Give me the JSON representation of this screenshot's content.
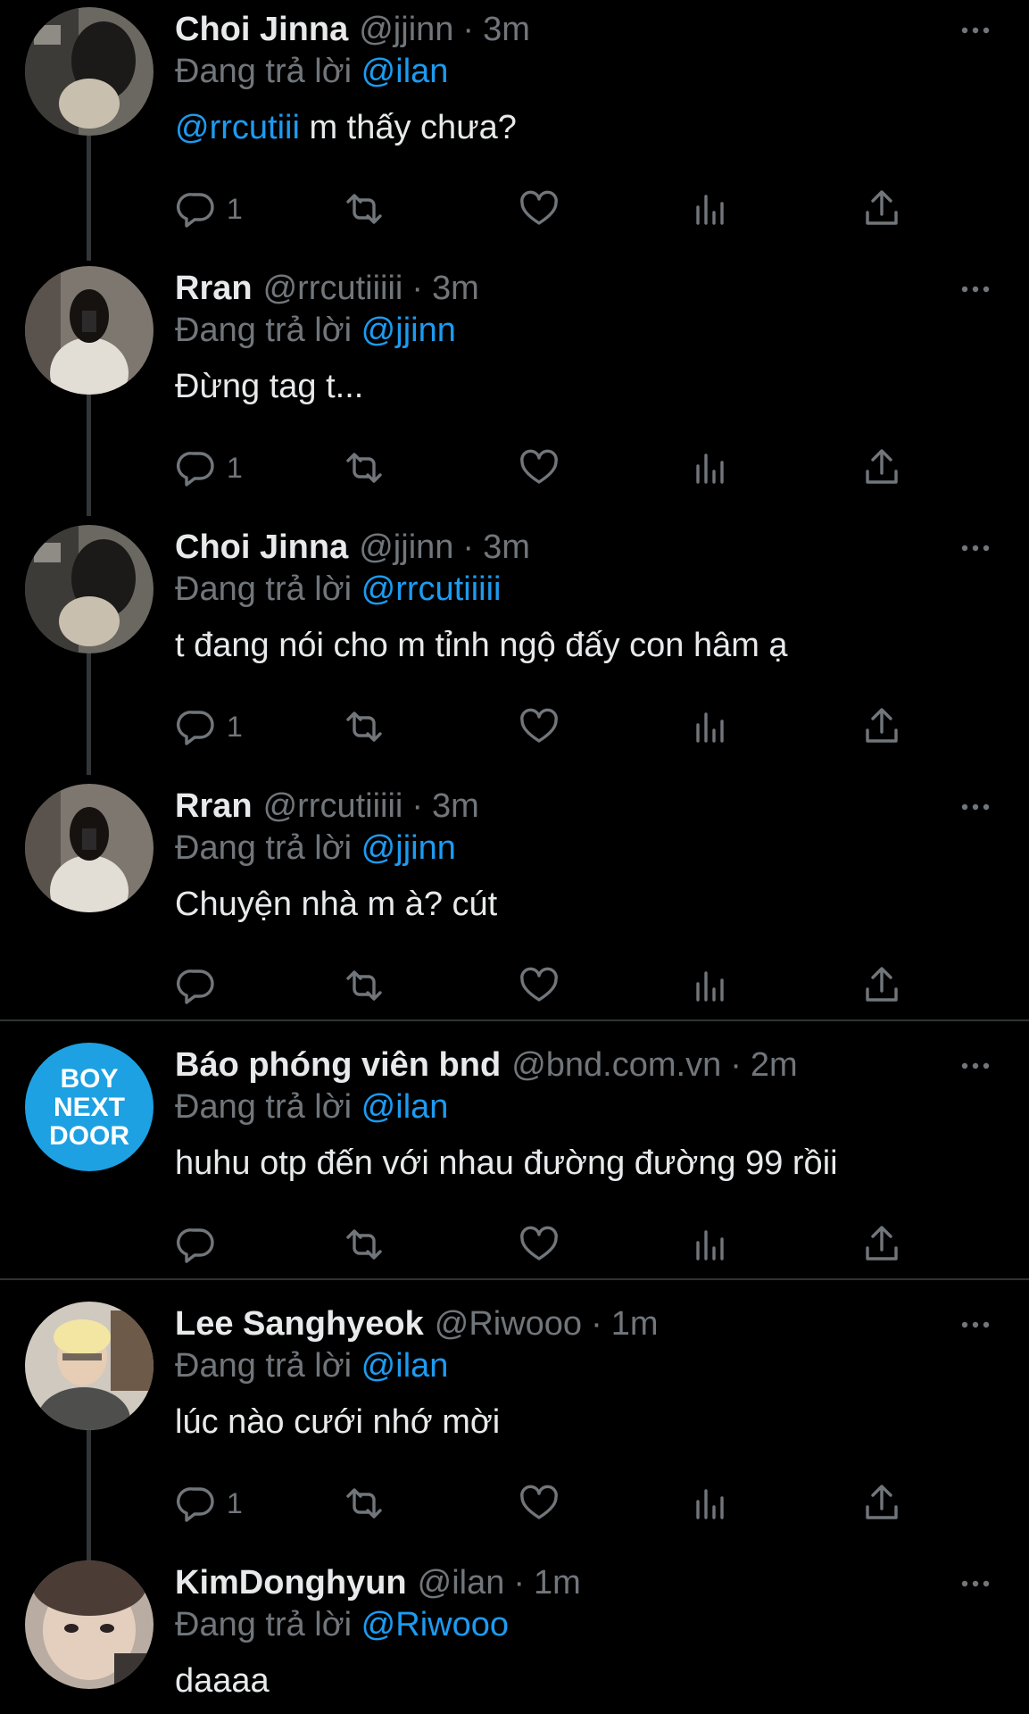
{
  "replying_prefix": "Đang trả lời",
  "tweets": [
    {
      "name": "Choi Jinna",
      "handle": "@jjinn",
      "time": "3m",
      "replying_to": "@ilan",
      "mention": "@rrcutiii",
      "text": " m thấy chưa?",
      "reply_count": "1"
    },
    {
      "name": "Rran",
      "handle": "@rrcutiiiii",
      "time": "3m",
      "replying_to": "@jjinn",
      "mention": "",
      "text": "Đừng tag t...",
      "reply_count": "1"
    },
    {
      "name": "Choi Jinna",
      "handle": "@jjinn",
      "time": "3m",
      "replying_to": "@rrcutiiiii",
      "mention": "",
      "text": "t đang nói cho m tỉnh ngộ đấy con hâm ạ",
      "reply_count": "1"
    },
    {
      "name": "Rran",
      "handle": "@rrcutiiiii",
      "time": "3m",
      "replying_to": "@jjinn",
      "mention": "",
      "text": "Chuyện nhà m à? cút",
      "reply_count": ""
    },
    {
      "name": "Báo phóng viên bnd",
      "handle": "@bnd.com.vn",
      "time": "2m",
      "replying_to": "@ilan",
      "mention": "",
      "text": "huhu otp đến với nhau đường đường 99 rồii",
      "reply_count": "",
      "avatar_text": [
        "BOY",
        "NEXT",
        "DOOR"
      ]
    },
    {
      "name": "Lee Sanghyeok",
      "handle": "@Riwooo",
      "time": "1m",
      "replying_to": "@ilan",
      "mention": "",
      "text": "lúc nào cưới nhớ mời",
      "reply_count": "1"
    },
    {
      "name": "KimDonghyun",
      "handle": "@ilan",
      "time": "1m",
      "replying_to": "@Riwooo",
      "mention": "",
      "text": "daaaa",
      "reply_count": ""
    }
  ],
  "colors": {
    "background": "#000000",
    "text": "#e7e9ea",
    "muted": "#71767b",
    "accent": "#1d9bf0",
    "bnd_avatar": "#1da1e2"
  },
  "icons": [
    "reply-icon",
    "retweet-icon",
    "like-icon",
    "views-icon",
    "share-icon",
    "more-icon"
  ]
}
